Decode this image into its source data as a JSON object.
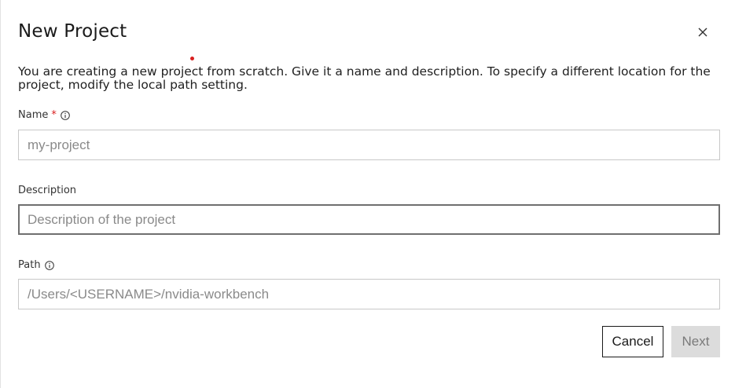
{
  "dialog": {
    "title": "New Project",
    "description": "You are creating a new project from scratch. Give it a name and description. To specify a different location for the project, modify the local path setting."
  },
  "fields": {
    "name": {
      "label": "Name",
      "required_marker": "*",
      "placeholder": "my-project",
      "value": ""
    },
    "description": {
      "label": "Description",
      "placeholder": "Description of the project",
      "value": ""
    },
    "path": {
      "label": "Path",
      "placeholder": "/Users/<USERNAME>/nvidia-workbench",
      "value": ""
    }
  },
  "actions": {
    "cancel_label": "Cancel",
    "next_label": "Next"
  },
  "colors": {
    "required": "#d92020",
    "next_disabled_bg": "#dcdcdc",
    "border": "#c8c8c8"
  },
  "icons": [
    "close-icon",
    "info-icon"
  ]
}
